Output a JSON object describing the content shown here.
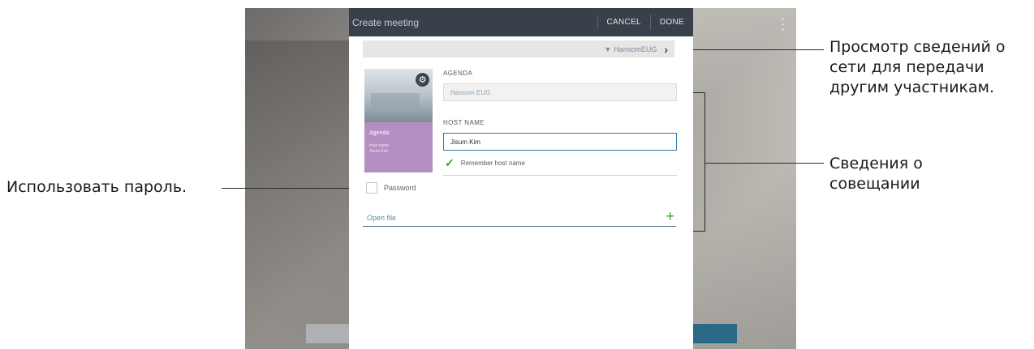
{
  "dialog": {
    "title": "Create meeting",
    "cancel_label": "CANCEL",
    "done_label": "DONE"
  },
  "network": {
    "name": "HansomEUG",
    "icon": "wifi-icon"
  },
  "thumbnail": {
    "title": "Agenda",
    "subtitle_line1": "Host name",
    "subtitle_line2": "Jisum Kim"
  },
  "form": {
    "agenda_label": "AGENDA",
    "agenda_value": "Hansom EUG",
    "host_label": "HOST NAME",
    "host_value": "Jisum Kim",
    "remember_label": "Remember host name",
    "remember_checked": true,
    "password_label": "Password",
    "password_checked": false,
    "open_file_label": "Open file"
  },
  "callouts": {
    "network_info": "Просмотр сведений о сети для передачи другим участникам.",
    "network_info_line1": "Просмотр сведений о",
    "network_info_line2": "сети для передачи",
    "network_info_line3": "другим участникам.",
    "meeting_info_line1": "Сведения о",
    "meeting_info_line2": "совещании",
    "use_password": "Использовать пароль."
  },
  "colors": {
    "header_bg": "#3a4049",
    "accent_green": "#3d9a3a",
    "accent_blue": "#2f7da0",
    "thumbnail_purple": "#b38fc4"
  }
}
